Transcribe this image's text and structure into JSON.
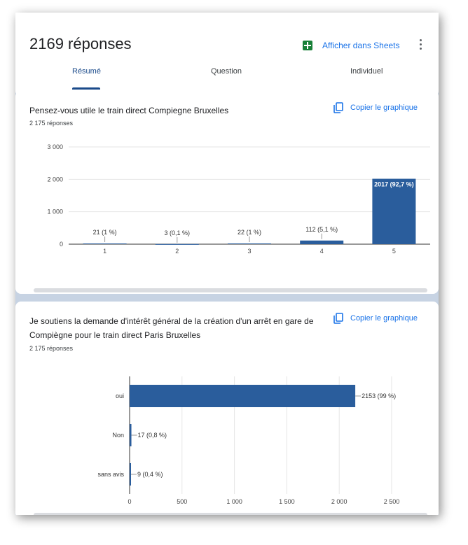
{
  "header": {
    "title": "2169 réponses",
    "sheets_label": "Afficher dans Sheets",
    "tabs": [
      "Résumé",
      "Question",
      "Individuel"
    ]
  },
  "copy_label": "Copier le graphique",
  "questions": [
    {
      "title": "Pensez-vous utile le train direct Compiegne Bruxelles",
      "count": "2 175 réponses"
    },
    {
      "title": "Je soutiens la demande d'intérêt général de la création d'un arrêt en gare de Compiègne pour le train direct Paris Bruxelles",
      "count": "2 175 réponses"
    }
  ],
  "colors": {
    "bar": "#2a5d9c",
    "accent": "#1a73e8",
    "sheets": "#188038"
  },
  "chart_data": [
    {
      "type": "bar",
      "categories": [
        "1",
        "2",
        "3",
        "4",
        "5"
      ],
      "values": [
        21,
        3,
        22,
        112,
        2017
      ],
      "labels": [
        "21 (1 %)",
        "3 (0,1 %)",
        "22 (1 %)",
        "112 (5,1 %)",
        "2017 (92,7 %)"
      ],
      "yticks": [
        "0",
        "1 000",
        "2 000",
        "3 000"
      ],
      "ylim": [
        0,
        3000
      ]
    },
    {
      "type": "bar",
      "orientation": "horizontal",
      "categories": [
        "oui",
        "Non",
        "sans avis"
      ],
      "values": [
        2153,
        17,
        9
      ],
      "labels": [
        "2153 (99 %)",
        "17 (0,8 %)",
        "9 (0,4 %)"
      ],
      "xticks": [
        "0",
        "500",
        "1 000",
        "1 500",
        "2 000",
        "2 500"
      ],
      "xlim": [
        0,
        2500
      ]
    }
  ]
}
